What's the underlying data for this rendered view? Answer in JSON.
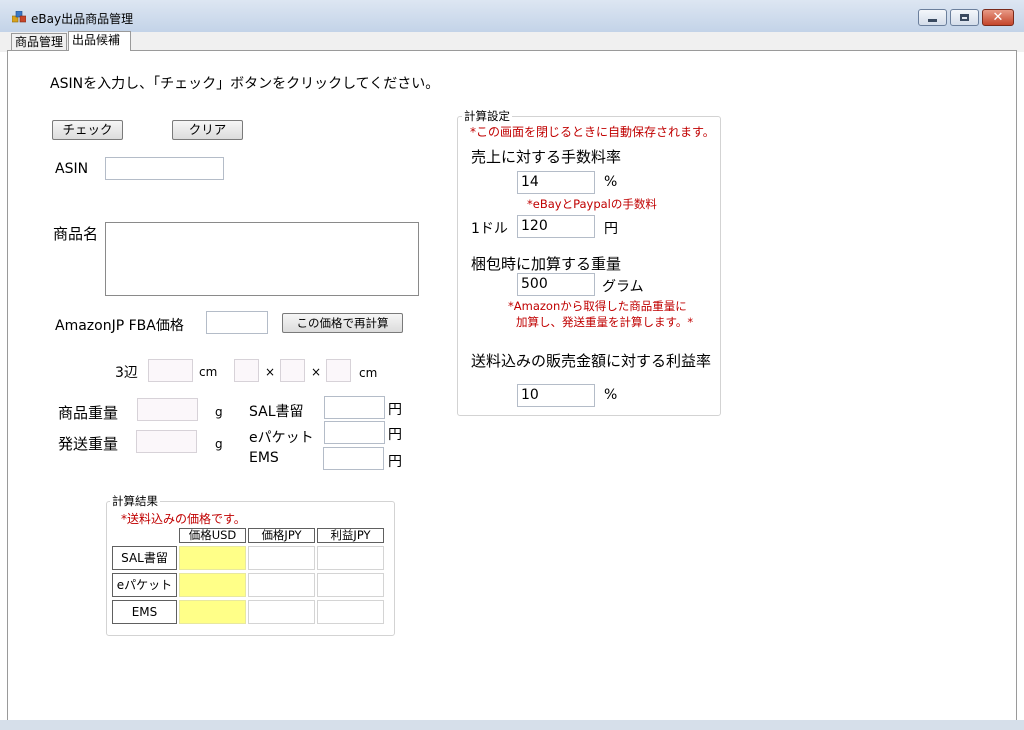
{
  "window": {
    "title": "eBay出品商品管理",
    "close_glyph": "✕",
    "icon": "app-icon"
  },
  "tabs": [
    {
      "label": "商品管理"
    },
    {
      "label": "出品候補"
    }
  ],
  "main": {
    "instruction": "ASINを入力し、「チェック」ボタンをクリックしてください。",
    "check_button": "チェック",
    "clear_button": "クリア",
    "asin_label": "ASIN",
    "asin_value": "",
    "product_name_label": "商品名",
    "product_name_value": "",
    "fba_price_label": "AmazonJP FBA価格",
    "fba_price_value": "",
    "recalc_button": "この価格で再計算",
    "dims_label": "3辺",
    "dims_unit1": "cm",
    "dims_times1": "×",
    "dims_times2": "×",
    "dims_unit2": "cm",
    "product_weight_label": "商品重量",
    "product_weight_unit": "g",
    "shipping_weight_label": "発送重量",
    "shipping_weight_unit": "g",
    "sal_label": "SAL書留",
    "sal_unit": "円",
    "epacket_label": "eパケット",
    "epacket_unit": "円",
    "ems_label": "EMS",
    "ems_unit": "円"
  },
  "results": {
    "title": "計算結果",
    "note": "*送料込みの価格です。",
    "columns": [
      "価格USD",
      "価格JPY",
      "利益JPY"
    ],
    "rows": [
      "SAL書留",
      "eパケット",
      "EMS"
    ],
    "highlight_color": "#ffff88"
  },
  "settings": {
    "title": "計算設定",
    "autosave_note": "*この画面を閉じるときに自動保存されます。",
    "fee_rate_label": "売上に対する手数料率",
    "fee_rate_value": "14",
    "fee_rate_unit": "%",
    "fee_note": "*eBayとPaypalの手数料",
    "dollar_label": "1ドル",
    "dollar_value": "120",
    "dollar_unit": "円",
    "packing_label": "梱包時に加算する重量",
    "packing_value": "500",
    "packing_unit": "グラム",
    "packing_note_line1": "*Amazonから取得した商品重量に",
    "packing_note_line2": "加算し、発送重量を計算します。*",
    "profit_label": "送料込みの販売金額に対する利益率",
    "profit_value": "10",
    "profit_unit": "%"
  }
}
